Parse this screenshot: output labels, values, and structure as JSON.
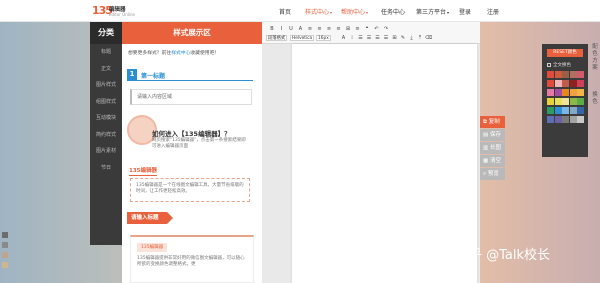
{
  "logo": {
    "mark": "135",
    "name": "编辑器",
    "sub": "Editor Online"
  },
  "nav": [
    {
      "label": "首页",
      "hot": false,
      "arrow": false
    },
    {
      "label": "样式中心",
      "hot": true,
      "arrow": true
    },
    {
      "label": "帮助中心",
      "hot": true,
      "arrow": true
    },
    {
      "label": "任务中心",
      "hot": false,
      "arrow": false
    },
    {
      "label": "第三方平台",
      "hot": false,
      "arrow": true
    },
    {
      "label": "登录",
      "hot": false,
      "arrow": false
    },
    {
      "label": "注册",
      "hot": false,
      "arrow": false
    }
  ],
  "categories": {
    "title": "分类",
    "items": [
      "标题",
      "正文",
      "图片样式",
      "组图样式",
      "互动模块",
      "简约样式",
      "图片素材",
      "节日"
    ]
  },
  "style_panel": {
    "title": "样式展示区",
    "tip_prefix": "想要更多样式？前往",
    "tip_link": "样式中心",
    "tip_suffix": "收藏使用吧！",
    "s1": {
      "num": "1",
      "title": "第一标题"
    },
    "s2": {
      "text": "请输入内容区域"
    },
    "s3": {
      "title": "如何进入【135编辑器】？",
      "desc": "网页搜索\"135编辑器\"，点击第一条搜索结果即可进入编辑器页面"
    },
    "s4": {
      "label": "135编辑器",
      "desc": "135编辑器是一个在线图文编辑工具，大量节省排版的时间，让工作更轻松高效。"
    },
    "s5": {
      "tag": "请输入标题"
    },
    "s6": {
      "badge": "135编辑器",
      "desc": "135编辑器提供非常好用的微信图文编辑器，可以随心所欲的变换颜色调整格式，更"
    }
  },
  "toolbar": {
    "row1": [
      "B",
      "I",
      "U",
      "A",
      "≡",
      "≡",
      "≡",
      "≡",
      "⊞",
      "≡",
      "❝",
      "↶",
      "↷"
    ],
    "row2": {
      "style": "段落格式",
      "font": "Helvetica",
      "size": "16px",
      "icons": [
        "A",
        "⁞",
        "☰",
        "☰",
        "☰",
        "☰",
        "⊞",
        "✎",
        "⤓",
        "⤒",
        "⌫"
      ]
    }
  },
  "side_actions": [
    "复制",
    "保存",
    "长图",
    "清空",
    "预览"
  ],
  "color_panel": {
    "reset": "RESET颜色",
    "apply_all": "全文换色",
    "swatches": [
      "#e24a3b",
      "#cf5a3c",
      "#9c5d49",
      "#b06f5f",
      "#d25a6a",
      "#e24a3b",
      "#f3b6b6",
      "#c25b4a",
      "#8d2222",
      "#d23f5b",
      "#e57ba5",
      "#a24ca5",
      "#e9871a",
      "#f1a142",
      "#f2b547",
      "#e5d437",
      "#e7e25a",
      "#f0e49c",
      "#8ab84a",
      "#5cad47",
      "#2c9c5f",
      "#2d8fd5",
      "#7bb7e4",
      "#86a8c4",
      "#3465a4",
      "#5b6fb2",
      "#6d5fa8",
      "#7b7b7b",
      "#a3a3a3",
      "#c9c9c9"
    ],
    "tab1": "配色方案",
    "tab2": "换色"
  },
  "bl_swatches": [
    "#6d6d6d",
    "#8a8a8a",
    "#bfa58c",
    "#d1b58e"
  ],
  "watermark": "知乎 @Talk校长"
}
